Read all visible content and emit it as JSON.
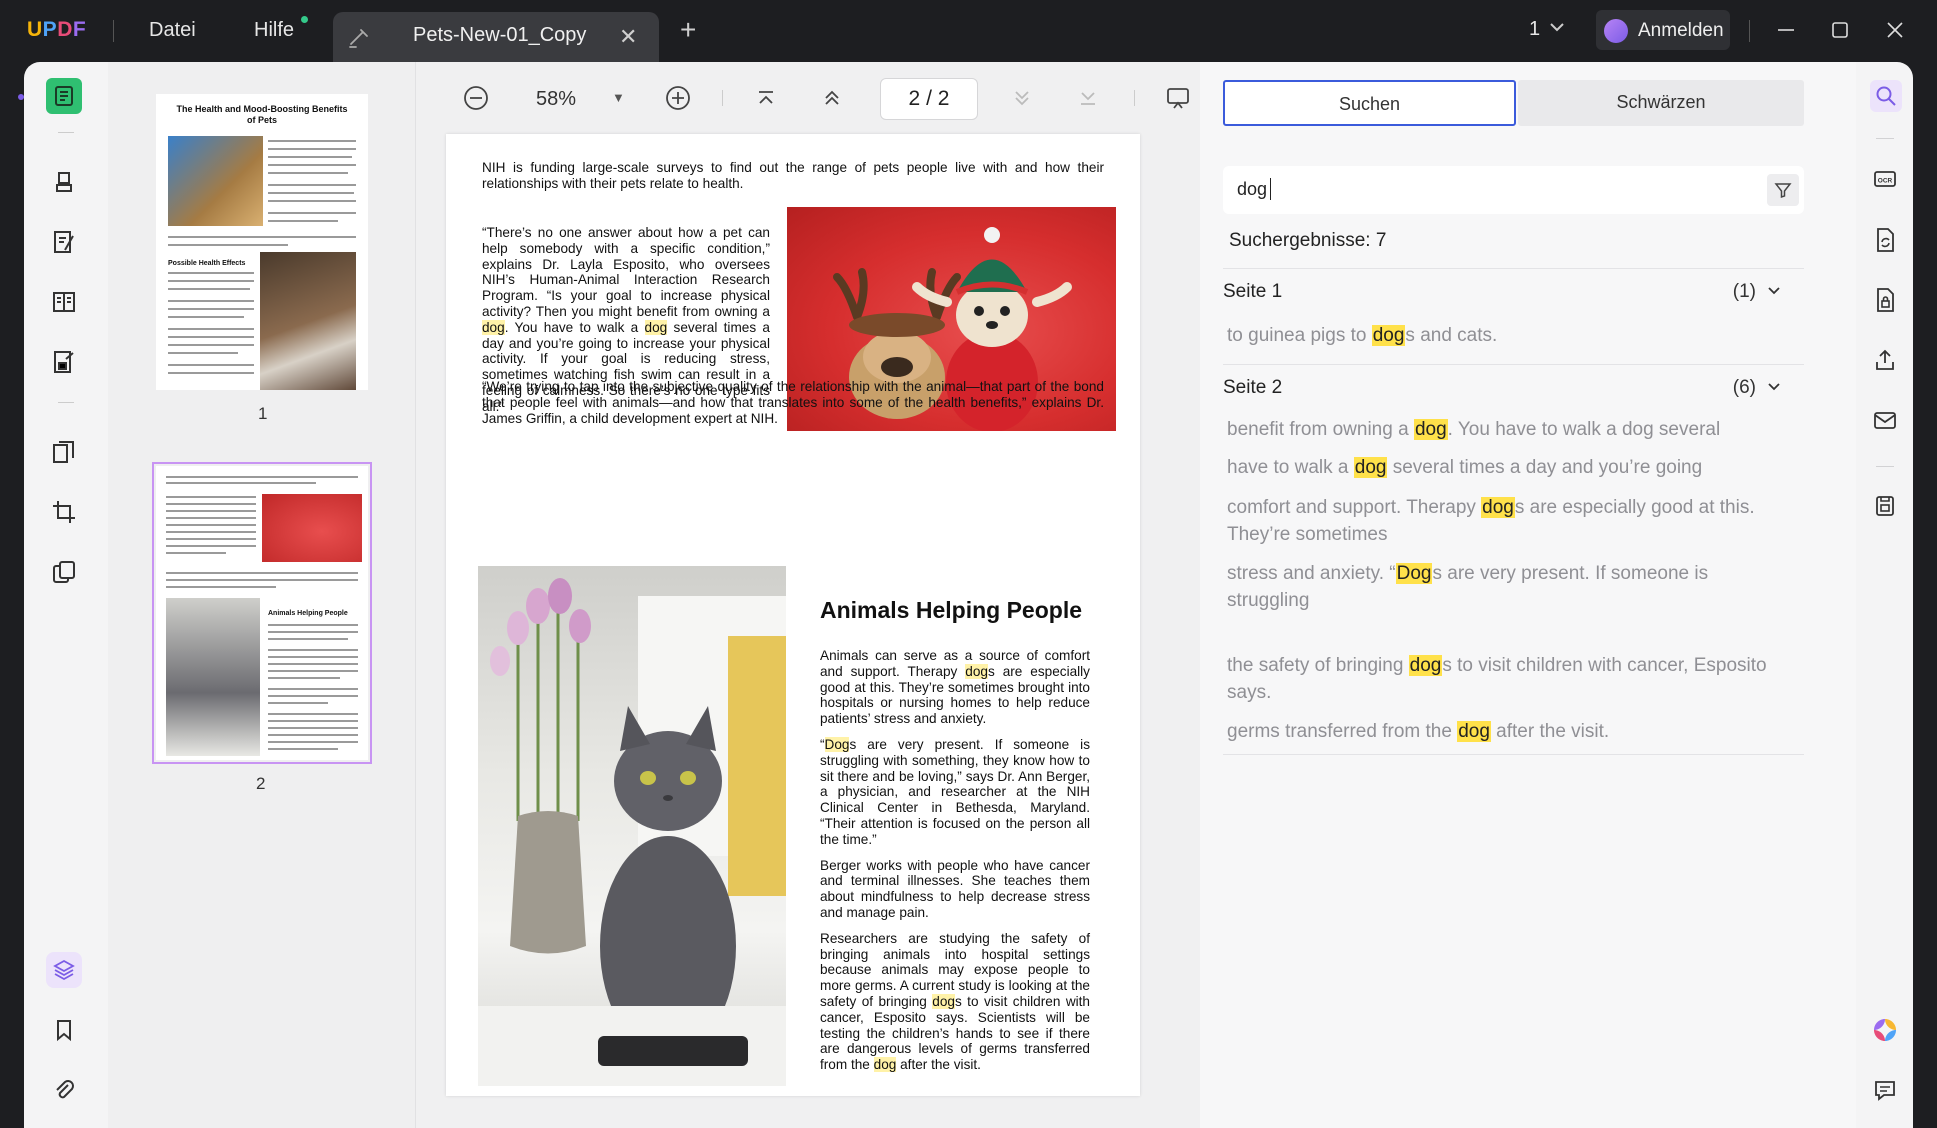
{
  "app": {
    "logo": {
      "u": "U",
      "p": "P",
      "d": "D",
      "f": "F"
    },
    "menu": [
      "Datei",
      "Hilfe"
    ],
    "tab_title": "Pets-New-01_Copy",
    "page_selector": "1",
    "signin": "Anmelden"
  },
  "toolbar": {
    "zoom": "58%",
    "page_current": "2",
    "page_sep": "/",
    "page_total": "2"
  },
  "thumbnails": [
    {
      "label": "1",
      "title": "The Health and Mood-Boosting Benefits of Pets",
      "heading": "Possible Health Effects"
    },
    {
      "label": "2",
      "heading": "Animals Helping People"
    }
  ],
  "document": {
    "para1": "NIH is funding large-scale surveys to find out the range of pets people live with and how their relationships with their pets relate to health.",
    "quote1_a": "“There’s no one answer about how a pet can help somebody with a specific condition,” explains Dr. Layla Esposito, who oversees NIH’s Human-Animal Interaction Research Program. “Is your goal to increase physical activity? Then you might benefit from owning a ",
    "quote1_b": ". You have to walk a ",
    "quote1_c": " several times a day and you’re going to increase your physical activity. If your goal is reducing stress, sometimes watching fish swim can result in a feeling of calmness. So there’s no one type fits all.”",
    "quote2": "“We’re trying to tap into the subjective quality of the relationship with the animal—that part of the bond that people feel with animals—and how that translates into some of the health benefits,” explains Dr. James Griffin, a child development expert at NIH.",
    "heading": "Animals Helping People",
    "p_a1": "Animals can serve as a source of comfort and support. Therapy ",
    "p_a2": "s are especially good at this. They’re sometimes brought into hospitals or nursing homes to help reduce patients’ stress and anxiety.",
    "p_b1": "“",
    "p_b2": "s are very present. If someone is struggling with something, they know how to sit there and be loving,” says Dr. Ann Berger, a physician, and researcher at the NIH Clinical Center in Bethesda, Maryland. “Their attention is focused on the person all the time.”",
    "p_c": "Berger works with people who have cancer and terminal illnesses. She teaches them about mindfulness to help decrease stress and manage pain.",
    "p_d1": "Researchers are studying the safety of bringing animals into hospital settings because animals may expose people to more germs. A current study is looking at the safety of bringing ",
    "p_d2": "s to visit children with cancer, Esposito says. Scientists will be testing the children’s hands to see if there are dangerous levels of germs transferred from the ",
    "p_d3": " after the visit.",
    "match_lower": "dog",
    "match_cap": "Dog"
  },
  "search": {
    "tab_search": "Suchen",
    "tab_redact": "Schwärzen",
    "query": "dog",
    "results_label": "Suchergebnisse: 7",
    "groups": [
      {
        "title": "Seite 1",
        "count": "(1)",
        "results": [
          {
            "pre": "to guinea pigs to ",
            "match": "dog",
            "post": "s and cats."
          }
        ]
      },
      {
        "title": "Seite 2",
        "count": "(6)",
        "results": [
          {
            "pre": "benefit from owning a ",
            "match": "dog",
            "post": ". You have to walk a dog several"
          },
          {
            "pre": "have to walk a ",
            "match": "dog",
            "post": " several times a day and you’re going"
          },
          {
            "pre": "comfort and support. Therapy ",
            "match": "dog",
            "post": "s are especially good at this. They’re sometimes"
          },
          {
            "pre": "stress and anxiety. “",
            "match": "Dog",
            "post": "s are very present. If someone is struggling"
          },
          {
            "pre": "the safety of bringing ",
            "match": "dog",
            "post": "s to visit children with cancer, Esposito says."
          },
          {
            "pre": "germs transferred from the ",
            "match": "dog",
            "post": " after the visit."
          }
        ]
      }
    ]
  },
  "colors": {
    "accent": "#3b5bdb",
    "highlight": "#ffe14a",
    "brand_green": "#2fbf71",
    "thumb_selected": "#c894f3"
  }
}
